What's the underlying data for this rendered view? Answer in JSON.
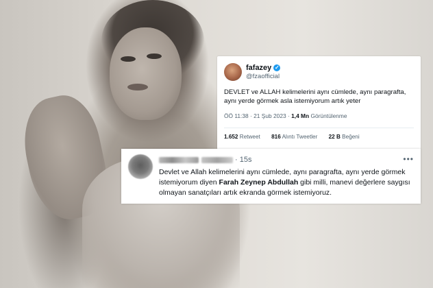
{
  "tweet_main": {
    "display_name": "fafazey",
    "handle": "@fzaofficial",
    "text": "DEVLET ve ALLAH kelimelerini aynı cümlede, aynı paragrafta, aynı yerde görmek asla istemiyorum artık yeter",
    "timestamp": "ÖÖ 11:38 · 21 Şub 2023 · ",
    "views_count": "1,4 Mn",
    "views_label": " Görüntülenme",
    "stats": {
      "retweets_count": "1.652",
      "retweets_label": " Retweet",
      "quotes_count": "816",
      "quotes_label": " Alıntı Tweetler",
      "likes_count": "22 B",
      "likes_label": " Beğeni"
    }
  },
  "tweet_reply": {
    "time": "· 15s",
    "more": "•••",
    "text_before": "Devlet ve Allah kelimelerini aynı cümlede, aynı paragrafta, aynı yerde görmek istemiyorum diyen ",
    "text_bold": "Farah Zeynep Abdullah",
    "text_after": "  gibi milli, manevi değerlere saygısı olmayan sanatçıları artık ekranda görmek istemiyoruz."
  },
  "colors": {
    "verified_badge": "#1d9bf0",
    "text_primary": "#0f1419",
    "text_secondary": "#536471"
  }
}
